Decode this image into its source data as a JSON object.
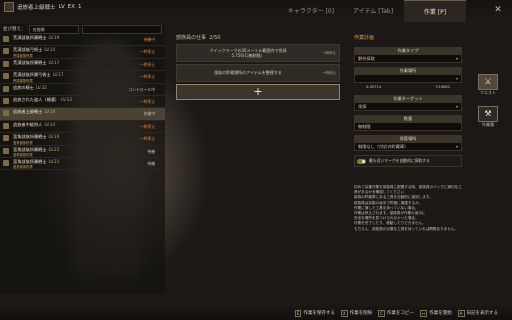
{
  "player": {
    "name": "追放者上級戦士",
    "tag": "LV",
    "rank": "EX",
    "extra": "1"
  },
  "tabs": [
    {
      "label": "キャラクター [0]",
      "active": false
    },
    {
      "label": "アイテム [Tab]",
      "active": false
    },
    {
      "label": "作業 [P]",
      "active": true
    }
  ],
  "list": {
    "sort_label": "並び替え：",
    "sort_value": "名前順",
    "items": [
      {
        "name": "荒漠部族所属戦士",
        "lv": "LV.19",
        "sub": "",
        "status": "待機中"
      },
      {
        "name": "荒漠部族弓術士",
        "lv": "LV.14",
        "sub": "荒漠部族所属",
        "status": "一時停止"
      },
      {
        "name": "荒漠部族所属戦士",
        "lv": "LV.17",
        "sub": "",
        "status": "一時停止"
      },
      {
        "name": "荒漠部族所属弓術士",
        "lv": "LV.17",
        "sub": "荒漠部族所属",
        "status": "一時停止"
      },
      {
        "name": "追放の騎士",
        "lv": "LV.32",
        "sub": "",
        "status": "コントロール中"
      },
      {
        "name": "追放された盗人（補遣）",
        "lv": "LV.13",
        "sub": "",
        "status": "一時停止"
      },
      {
        "name": "追放者上級戦士",
        "lv": "LV.18",
        "sub": "",
        "status": "作業中"
      },
      {
        "name": "追放者中級狩人",
        "lv": "LV.14",
        "sub": "",
        "status": "一時停止"
      },
      {
        "name": "蛮角部族所属戦士",
        "lv": "LV.16",
        "sub": "蛮角部族所属",
        "status": "一時停止"
      },
      {
        "name": "蛮角部族所属戦士",
        "lv": "LV.22",
        "sub": "蛮角部族所属",
        "status": "待機"
      },
      {
        "name": "蛮角部族所属戦士",
        "lv": "LV.21",
        "sub": "蛮角部族所属",
        "status": "待機"
      }
    ]
  },
  "tasks_panel": {
    "title": "部族員の仕事",
    "count": "2/50",
    "tasks": [
      {
        "text": "クイックマークの30メートル範囲内で伐採\n5,756(1)無制限）",
        "lock": "一時停止"
      },
      {
        "text": "部族の貯蔵場所のアイテムを整理する",
        "lock": "一時停止"
      }
    ],
    "add_label": "+"
  },
  "plan": {
    "title": "作業計画",
    "type_label": "作業タイプ",
    "type_value": "野外採取",
    "location_label": "作業場所",
    "location_value": "",
    "coord_x": "X:30714",
    "coord_y": "Y:16662",
    "target_label": "作業ターゲット",
    "target_value": "伐採",
    "qty_label": "数量",
    "qty_value": "無制限",
    "store_label": "保管場所",
    "store_value": "制限なし（付近の貯蔵庫）",
    "toggle_text": "最も近いマークを自動的に採取する",
    "desc": "初めて採集作業を部族員に配置する時、部族員のバッグに適切な工具があるかを確認してください\n部族の貯蔵庫にある工具を自動的に使用します。\n部族員は採取の途中で貯蔵に適運するか、\n作業に適した工具を持っていない場合、\n作業は停止されます。部族員が作業の途中に\n安全な場所を見つけられなかった場合、\n作業を完了したり、移動したりできません。\nもちろん、部族員が必要な工具を持っていれば問題ありません。"
  },
  "side": [
    {
      "label": "クエスト",
      "icon": "quest-icon"
    },
    {
      "label": "作業場",
      "icon": "workshop-icon"
    }
  ],
  "bottom": [
    {
      "key": "E",
      "label": "作業を保存する"
    },
    {
      "key": "X",
      "label": "作業を削除"
    },
    {
      "key": "C",
      "label": "作業をコピー"
    },
    {
      "key": "↔",
      "label": "作業を開始"
    },
    {
      "key": "A",
      "label": "日記を表示する"
    }
  ]
}
